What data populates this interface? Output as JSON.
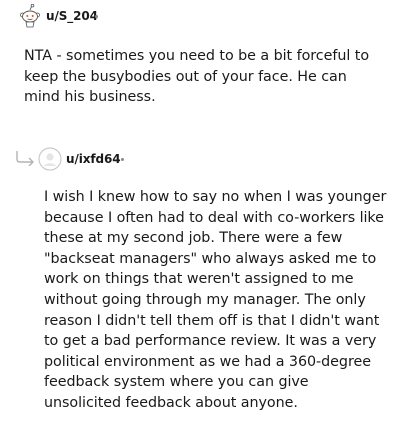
{
  "comments": [
    {
      "username": "u/S_204",
      "avatar_icon": "snoo-avatar-icon",
      "body": "NTA - sometimes you need to be a bit forceful to keep the busybodies out of your face. He can mind his business."
    },
    {
      "username": "u/ixfd64",
      "avatar_icon": "default-avatar-icon",
      "reply_icon": "reply-arrow-icon",
      "body": "I wish I knew how to say no when I was younger because I often had to deal with co-workers like these at my second job. There were a few \"backseat managers\" who always asked me to work on things that weren't assigned to me without going through my manager. The only reason I didn't tell them off is that I didn't want to get a bad performance review. It was a very political environment as we had a 360-degree feedback system where you can give unsolicited feedback about anyone."
    }
  ],
  "colors": {
    "text": "#1a1a1b",
    "meta_gray": "#878a8c",
    "avatar_outline": "#c8cbcd"
  }
}
